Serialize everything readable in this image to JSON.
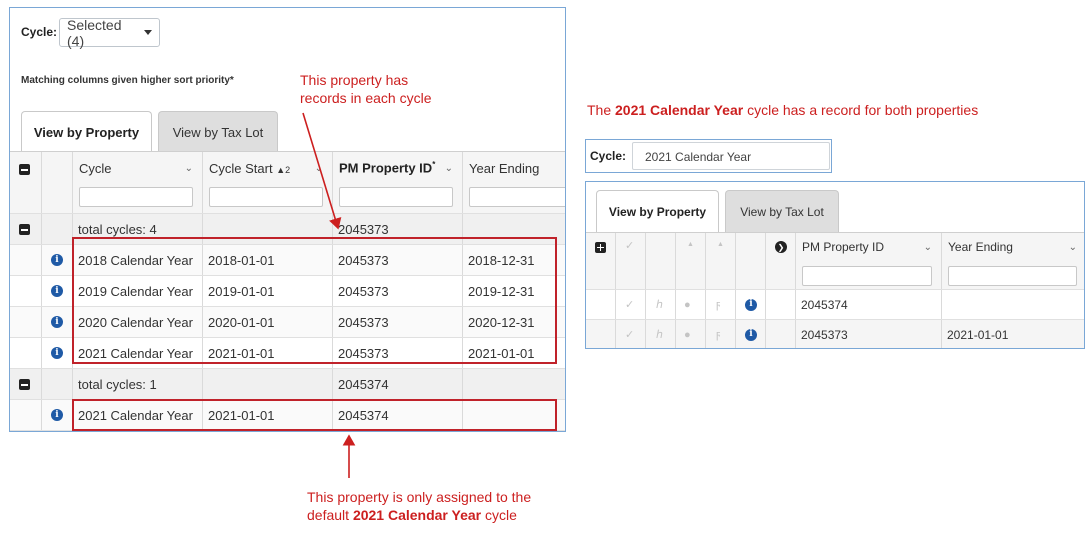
{
  "left": {
    "cycle_label": "Cycle:",
    "cycle_selected": "Selected (4)",
    "matching_note": "Matching columns given higher sort priority*",
    "tabs": [
      {
        "label": "View by Property"
      },
      {
        "label": "View by Tax Lot"
      }
    ],
    "columns": {
      "cycle": "Cycle",
      "cycle_start": "Cycle Start",
      "cycle_start_sort": "▲2",
      "pm_property_id": "PM Property ID",
      "pm_property_id_mark": "*",
      "year_ending": "Year Ending"
    },
    "groups": [
      {
        "summary": "total cycles: 4",
        "pm_id": "2045373",
        "rows": [
          {
            "cycle": "2018 Calendar Year",
            "start": "2018-01-01",
            "pm_id": "2045373",
            "year_ending": "2018-12-31"
          },
          {
            "cycle": "2019 Calendar Year",
            "start": "2019-01-01",
            "pm_id": "2045373",
            "year_ending": "2019-12-31"
          },
          {
            "cycle": "2020 Calendar Year",
            "start": "2020-01-01",
            "pm_id": "2045373",
            "year_ending": "2020-12-31"
          },
          {
            "cycle": "2021 Calendar Year",
            "start": "2021-01-01",
            "pm_id": "2045373",
            "year_ending": "2021-01-01"
          }
        ]
      },
      {
        "summary": "total cycles: 1",
        "pm_id": "2045374",
        "rows": [
          {
            "cycle": "2021 Calendar Year",
            "start": "2021-01-01",
            "pm_id": "2045374",
            "year_ending": ""
          }
        ]
      }
    ]
  },
  "annotations": {
    "top_line1": "This property has",
    "top_line2": "records in each cycle",
    "bottom_line1": "This property is only assigned to the",
    "bottom_line2_pre": "default ",
    "bottom_line2_bold": "2021 Calendar Year",
    "bottom_line2_post": " cycle",
    "right_pre": "The ",
    "right_bold": "2021 Calendar Year",
    "right_post": " cycle has a record for both properties",
    "color": "#cc1f1f"
  },
  "right": {
    "cycle_label": "Cycle:",
    "cycle_value": "2021 Calendar Year",
    "tabs": [
      {
        "label": "View by Property"
      },
      {
        "label": "View by Tax Lot"
      }
    ],
    "columns": {
      "pm_property_id": "PM Property ID",
      "year_ending": "Year Ending"
    },
    "rows": [
      {
        "pm_id": "2045374",
        "year_ending": ""
      },
      {
        "pm_id": "2045373",
        "year_ending": "2021-01-01"
      }
    ]
  }
}
